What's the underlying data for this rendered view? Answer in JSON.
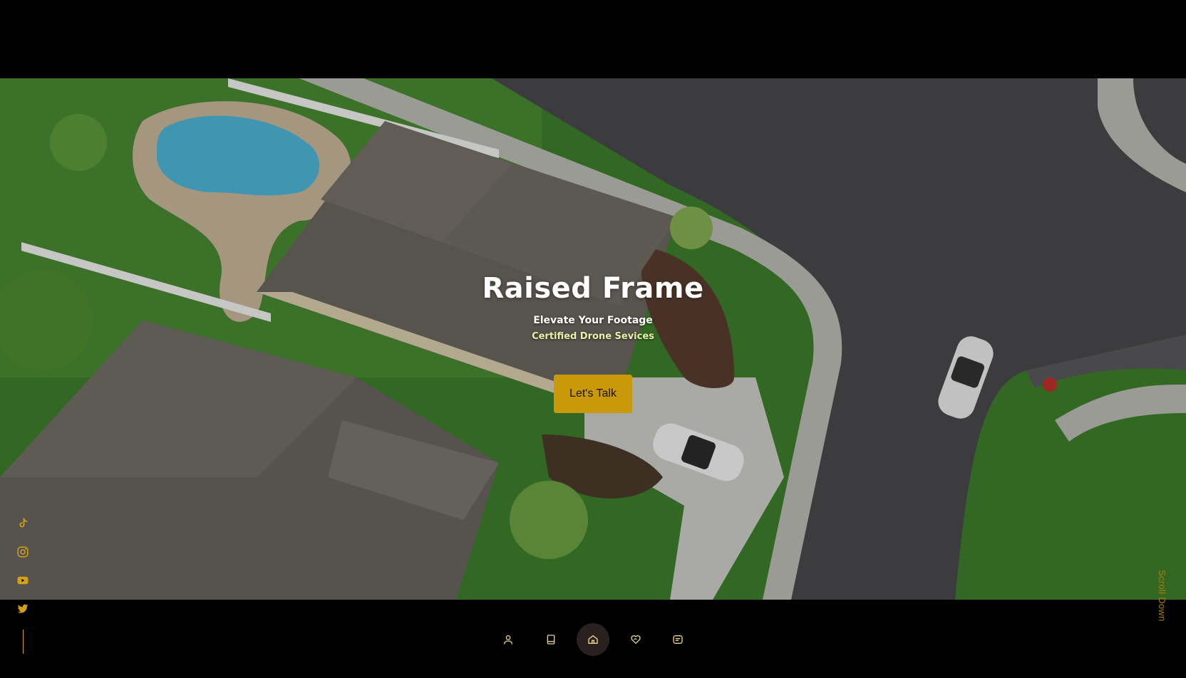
{
  "hero": {
    "title": "Raised Frame",
    "subtitle": "Elevate Your Footage",
    "tagline": "Certified Drone Sevices",
    "cta_label": "Let's Talk",
    "background_image": "aerial-view-of-suburban-houses"
  },
  "social": [
    {
      "name": "tiktok-icon"
    },
    {
      "name": "instagram-icon"
    },
    {
      "name": "youtube-icon"
    },
    {
      "name": "twitter-icon"
    }
  ],
  "nav": {
    "items": [
      {
        "name": "about",
        "icon": "user-icon"
      },
      {
        "name": "book",
        "icon": "book-icon"
      },
      {
        "name": "home",
        "icon": "home-icon",
        "active": true
      },
      {
        "name": "services",
        "icon": "heart-handshake-icon"
      },
      {
        "name": "contact",
        "icon": "message-icon"
      }
    ]
  },
  "scroll": {
    "label": "Scroll Down"
  },
  "colors": {
    "accent": "#c9980b",
    "accent_text": "#d4a015",
    "background": "#000000",
    "tagline": "#e4f3a8"
  }
}
